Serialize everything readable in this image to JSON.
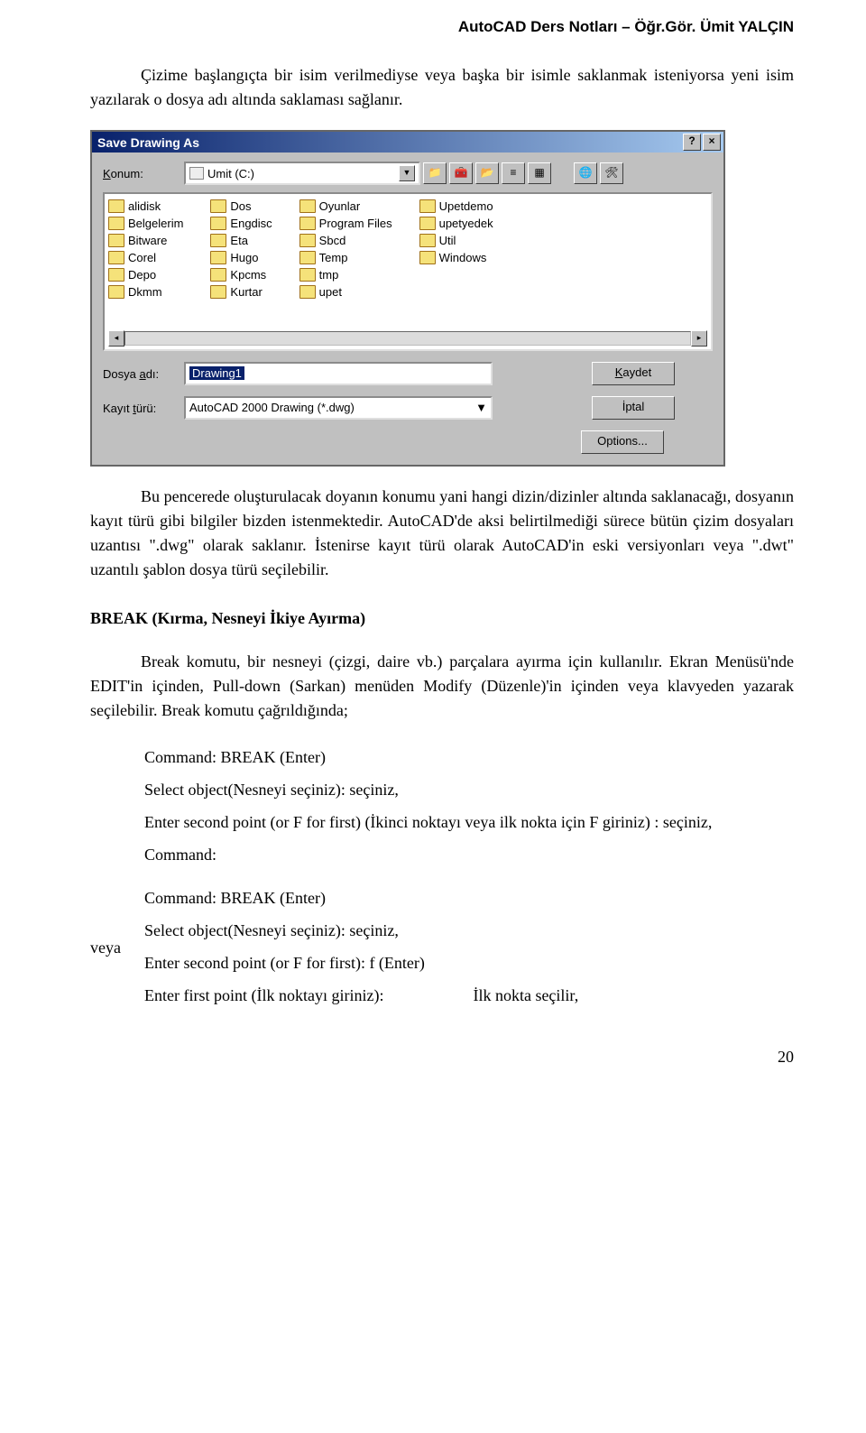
{
  "header": {
    "text": "AutoCAD Ders Notları – Öğr.Gör. Ümit YALÇIN"
  },
  "para1": "Çizime başlangıçta bir isim verilmediyse veya başka bir isimle saklanmak isteniyorsa yeni isim yazılarak o dosya adı altında saklaması sağlanır.",
  "dialog": {
    "title": "Save Drawing As",
    "help": "?",
    "close": "×",
    "konum_label": "Konum:",
    "konum_value": "Umit (C:)",
    "folders_col1": [
      "alidisk",
      "Belgelerim",
      "Bitware",
      "Corel",
      "Depo",
      "Dkmm"
    ],
    "folders_col2": [
      "Dos",
      "Engdisc",
      "Eta",
      "Hugo",
      "Kpcms",
      "Kurtar"
    ],
    "folders_col3": [
      "Oyunlar",
      "Program Files",
      "Sbcd",
      "Temp",
      "tmp",
      "upet"
    ],
    "folders_col4": [
      "Upetdemo",
      "upetyedek",
      "Util",
      "Windows"
    ],
    "dosya_label": "Dosya adı:",
    "dosya_value": "Drawing1",
    "kayit_label": "Kayıt türü:",
    "kayit_value": "AutoCAD 2000 Drawing (*.dwg)",
    "kaydet": "Kaydet",
    "iptal": "İptal",
    "options": "Options..."
  },
  "para2": "Bu pencerede oluşturulacak doyanın konumu yani hangi dizin/dizinler altında saklanacağı, dosyanın kayıt türü gibi bilgiler bizden istenmektedir. AutoCAD'de aksi belirtilmediği sürece bütün çizim dosyaları uzantısı \".dwg\" olarak saklanır. İstenirse kayıt türü olarak AutoCAD'in eski versiyonları veya \".dwt\" uzantılı şablon dosya türü seçilebilir.",
  "heading": "BREAK (Kırma, Nesneyi İkiye Ayırma)",
  "para3": "Break komutu, bir nesneyi (çizgi, daire vb.) parçalara ayırma için kullanılır. Ekran Menüsü'nde EDIT'in içinden, Pull-down (Sarkan) menüden Modify (Düzenle)'in içinden veya klavyeden yazarak seçilebilir. Break komutu çağrıldığında;",
  "veya": "veya",
  "cmds": {
    "l1": "Command: BREAK (Enter)",
    "l2": "Select object(Nesneyi seçiniz): seçiniz,",
    "l3": "Enter second point (or F for first) (İkinci noktayı veya ilk nokta için F giriniz) : seçiniz,",
    "l4": "Command:",
    "l5": "Command: BREAK (Enter)",
    "l6": "Select object(Nesneyi seçiniz): seçiniz,",
    "l7": "Enter second point (or F for first): f  (Enter)",
    "l8a": "Enter first point (İlk noktayı giriniz):",
    "l8b": "İlk nokta seçilir,"
  },
  "pagenum": "20"
}
